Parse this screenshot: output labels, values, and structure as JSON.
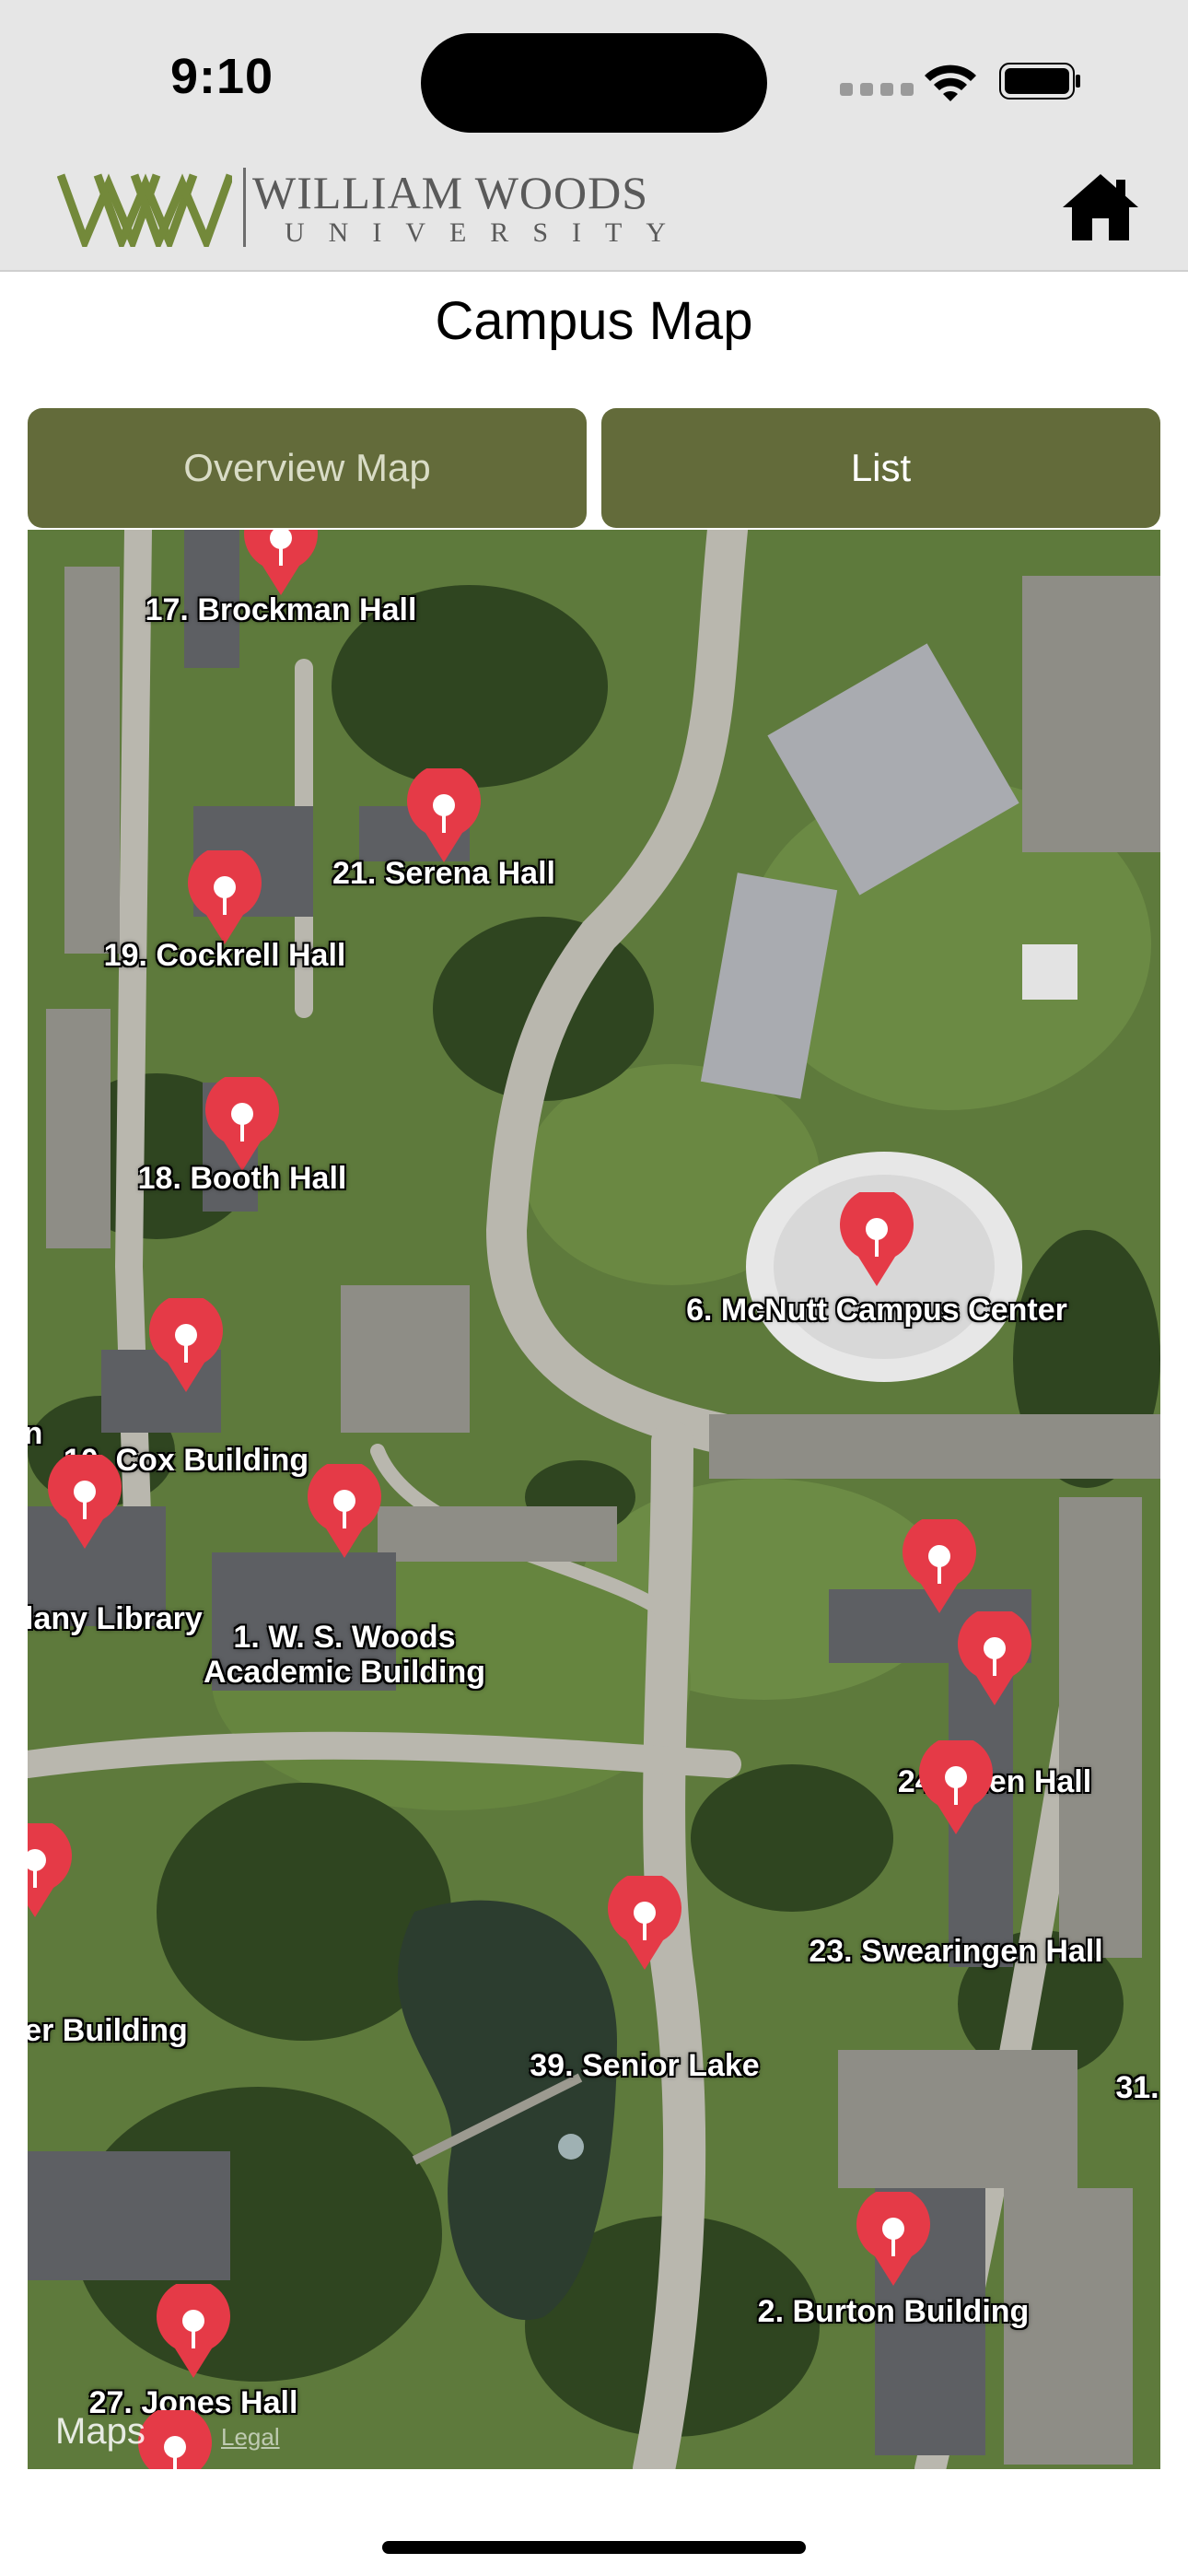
{
  "status_bar": {
    "time": "9:10"
  },
  "header": {
    "logo_title": "WILLIAM WOODS",
    "logo_subtitle": "UNIVERSITY",
    "home_icon": "home-icon"
  },
  "page": {
    "title": "Campus Map"
  },
  "segments": {
    "overview_label": "Overview Map",
    "list_label": "List"
  },
  "map": {
    "brand": " Maps",
    "legal": "Legal",
    "pins": [
      {
        "label": "17. Brockman Hall"
      },
      {
        "label": "21. Serena Hall"
      },
      {
        "label": "19. Cockrell Hall"
      },
      {
        "label": "18. Booth Hall"
      },
      {
        "label": "6. McNutt Campus Center"
      },
      {
        "label": "10. Cox Building"
      },
      {
        "label": "ulany Library"
      },
      {
        "label": "1. W. S. Woods Academic Building"
      },
      {
        "label": "24. Allen Hall"
      },
      {
        "label": "23. Swearingen Hall"
      },
      {
        "label": "er Building"
      },
      {
        "label": "39. Senior Lake"
      },
      {
        "label": "31."
      },
      {
        "label": "2. Burton Building"
      },
      {
        "label": "27. Jones Hall"
      },
      {
        "label": "n"
      }
    ]
  },
  "colors": {
    "accent": "#636b3a",
    "pin": "#e53a47"
  }
}
